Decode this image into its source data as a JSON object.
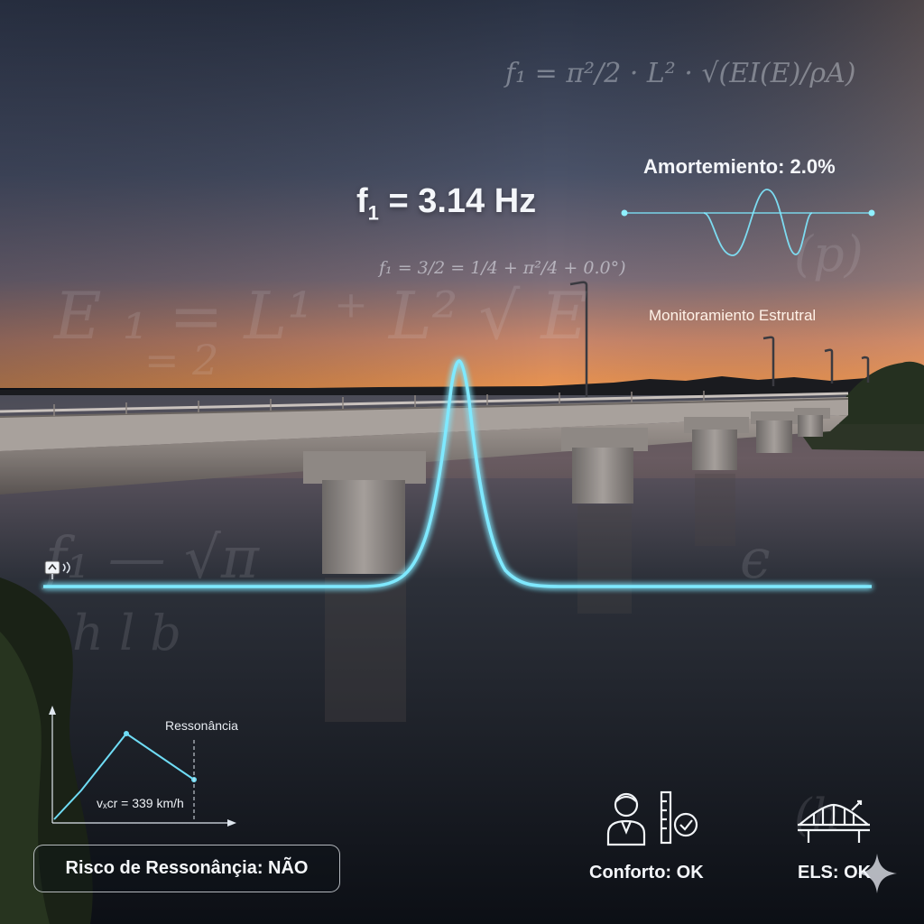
{
  "headline": {
    "frequency_symbol": "f",
    "frequency_subscript": "1",
    "frequency_value": "= 3.14 Hz"
  },
  "formulas": {
    "top": "f₁ = π²/2 · L² · √(EI(E)/ρA)",
    "middle": "f₁ = 3/2 = 1/4 + π²/4 + 0.0°)"
  },
  "damping": {
    "label": "Amortemiento: 2.0%"
  },
  "monitoring": {
    "label": "Monitoramiento Estrutral"
  },
  "resonance_chart": {
    "peak_label": "Ressonância",
    "critical_speed_label": "vₓcr = 339 km/h"
  },
  "status": {
    "risk_label": "Risco de Ressonânçia: NÃO",
    "comfort_label": "Conforto: OK",
    "els_label": "ELS: OK"
  },
  "icons": [
    "sensor-icon",
    "person-icon",
    "ruler-check-icon",
    "bridge-icon",
    "sparkle-icon"
  ],
  "colors": {
    "signal_cyan": "#7fe9ff",
    "sky_top": "#2c3548",
    "horizon_orange": "#e38a4f",
    "water_dark": "#0e121a"
  }
}
